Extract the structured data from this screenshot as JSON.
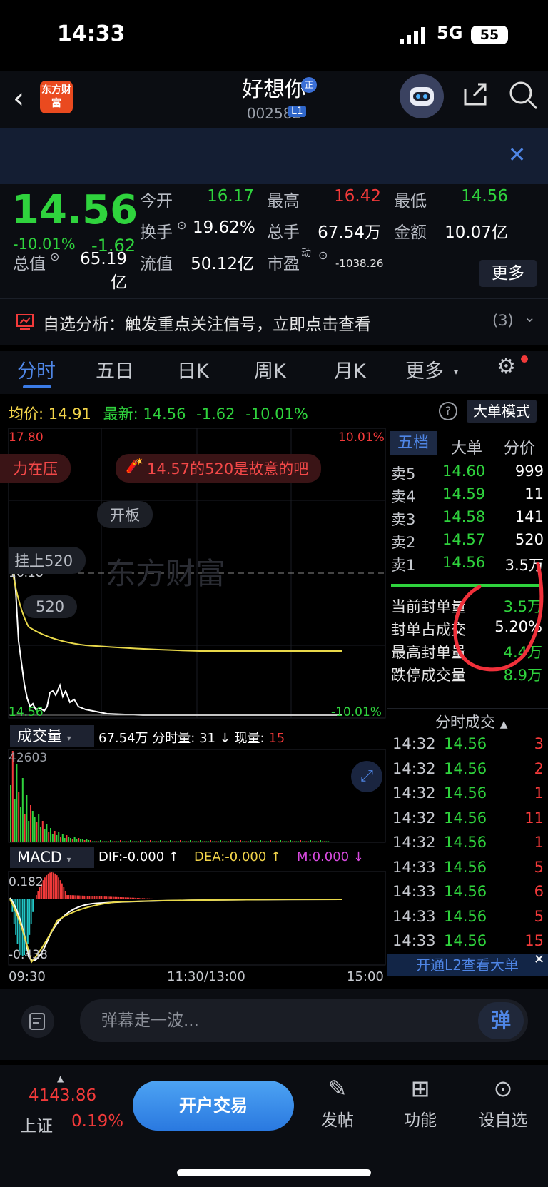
{
  "status_bar": {
    "time": "14:33",
    "network": "5G",
    "battery": "55"
  },
  "header": {
    "logo_text": "东方财富",
    "stock_name": "好想你",
    "badge": "正",
    "stock_code": "002582",
    "level_badge": "L1"
  },
  "quote": {
    "price": "14.56",
    "change_pct": "-10.01%",
    "change": "-1.62",
    "fields": [
      {
        "label": "今开",
        "value": "16.17",
        "color": "green"
      },
      {
        "label": "最高",
        "value": "16.42",
        "color": "red"
      },
      {
        "label": "最低",
        "value": "14.56",
        "color": "green"
      },
      {
        "label": "换手",
        "value": "19.62%",
        "color": "white"
      },
      {
        "label": "总手",
        "value": "67.54万",
        "color": "white"
      },
      {
        "label": "金额",
        "value": "10.07亿",
        "color": "white"
      },
      {
        "label": "总值",
        "value": "65.19亿",
        "color": "white"
      },
      {
        "label": "流值",
        "value": "50.12亿",
        "color": "white"
      },
      {
        "label": "市盈",
        "value": "-1038.26",
        "color": "white",
        "sup": "动"
      }
    ],
    "more_label": "更多"
  },
  "analysis": {
    "text": "自选分析：触发重点关注信号，立即点击查看",
    "count": "(3)"
  },
  "tabs": [
    "分时",
    "五日",
    "日K",
    "周K",
    "月K",
    "更多"
  ],
  "intraday": {
    "avg_label": "均价:",
    "avg_value": "14.91",
    "latest_label": "最新:",
    "latest_value": "14.56",
    "latest_change": "-1.62",
    "latest_pct": "-10.01%",
    "big_order_mode": "大单模式",
    "y_top": "17.80",
    "y_top_pct": "10.01%",
    "y_mid": "16.18",
    "y_bottom": "14.56",
    "y_bottom_pct": "-10.01%",
    "chips": {
      "red1": "力在压",
      "red2": "14.57的520是故意的吧",
      "grey1": "开板",
      "grey2": "挂上520",
      "grey3": "520"
    },
    "watermark": "东方财富"
  },
  "volume": {
    "label": "成交量",
    "total": "67.54万",
    "minute_label": "分时量:",
    "minute_value": "31",
    "now_label": "现量:",
    "now_value": "15",
    "max": "42603"
  },
  "macd": {
    "label": "MACD",
    "dif": "DIF:-0.000 ↑",
    "dea": "DEA:-0.000 ↑",
    "m": "M:0.000 ↓",
    "top": "0.182",
    "bottom": "-0.438"
  },
  "time_axis": {
    "start": "09:30",
    "mid": "11:30/13:00",
    "end": "15:00"
  },
  "order_book": {
    "tabs": [
      "五档",
      "大单",
      "分价"
    ],
    "asks": [
      {
        "label": "卖5",
        "price": "14.60",
        "vol": "999"
      },
      {
        "label": "卖4",
        "price": "14.59",
        "vol": "11"
      },
      {
        "label": "卖3",
        "price": "14.58",
        "vol": "141"
      },
      {
        "label": "卖2",
        "price": "14.57",
        "vol": "520"
      },
      {
        "label": "卖1",
        "price": "14.56",
        "vol": "3.5万"
      }
    ],
    "stats": [
      {
        "label": "当前封单量",
        "value": "3.5万"
      },
      {
        "label": "封单占成交",
        "value": "5.20%"
      },
      {
        "label": "最高封单量",
        "value": "4.4万"
      },
      {
        "label": "跌停成交量",
        "value": "8.9万"
      }
    ],
    "ticks_title": "分时成交",
    "ticks": [
      {
        "time": "14:32",
        "price": "14.56",
        "vol": "3"
      },
      {
        "time": "14:32",
        "price": "14.56",
        "vol": "2"
      },
      {
        "time": "14:32",
        "price": "14.56",
        "vol": "1"
      },
      {
        "time": "14:32",
        "price": "14.56",
        "vol": "11"
      },
      {
        "time": "14:32",
        "price": "14.56",
        "vol": "1"
      },
      {
        "time": "14:33",
        "price": "14.56",
        "vol": "5"
      },
      {
        "time": "14:33",
        "price": "14.56",
        "vol": "6"
      },
      {
        "time": "14:33",
        "price": "14.56",
        "vol": "5"
      },
      {
        "time": "14:33",
        "price": "14.56",
        "vol": "15"
      }
    ],
    "l2_banner": "开通L2查看大单"
  },
  "danmu": {
    "placeholder": "弹幕走一波...",
    "button": "弹"
  },
  "footer": {
    "index_value": "4143.86",
    "index_name": "上证",
    "index_pct": "0.19%",
    "open_button": "开户交易",
    "items": [
      "发帖",
      "功能",
      "设自选"
    ]
  }
}
